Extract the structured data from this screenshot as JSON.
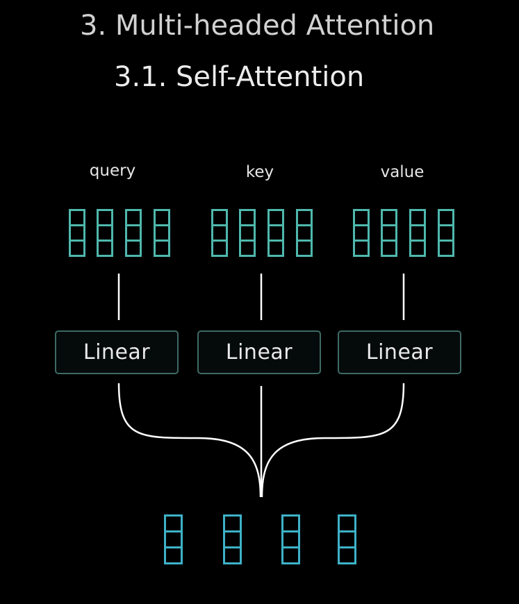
{
  "title": {
    "section": "3. Multi-headed Attention",
    "subsection": "3.1. Self-Attention"
  },
  "inputs": [
    {
      "label": "query"
    },
    {
      "label": "key"
    },
    {
      "label": "value"
    }
  ],
  "linear_layers": [
    {
      "label": "Linear"
    },
    {
      "label": "Linear"
    },
    {
      "label": "Linear"
    }
  ],
  "colors": {
    "background": "#000000",
    "input_vector": "#4fb8ad",
    "output_vector": "#3eb2c8",
    "box_border": "#3e6a65",
    "wire": "#ffffff"
  }
}
